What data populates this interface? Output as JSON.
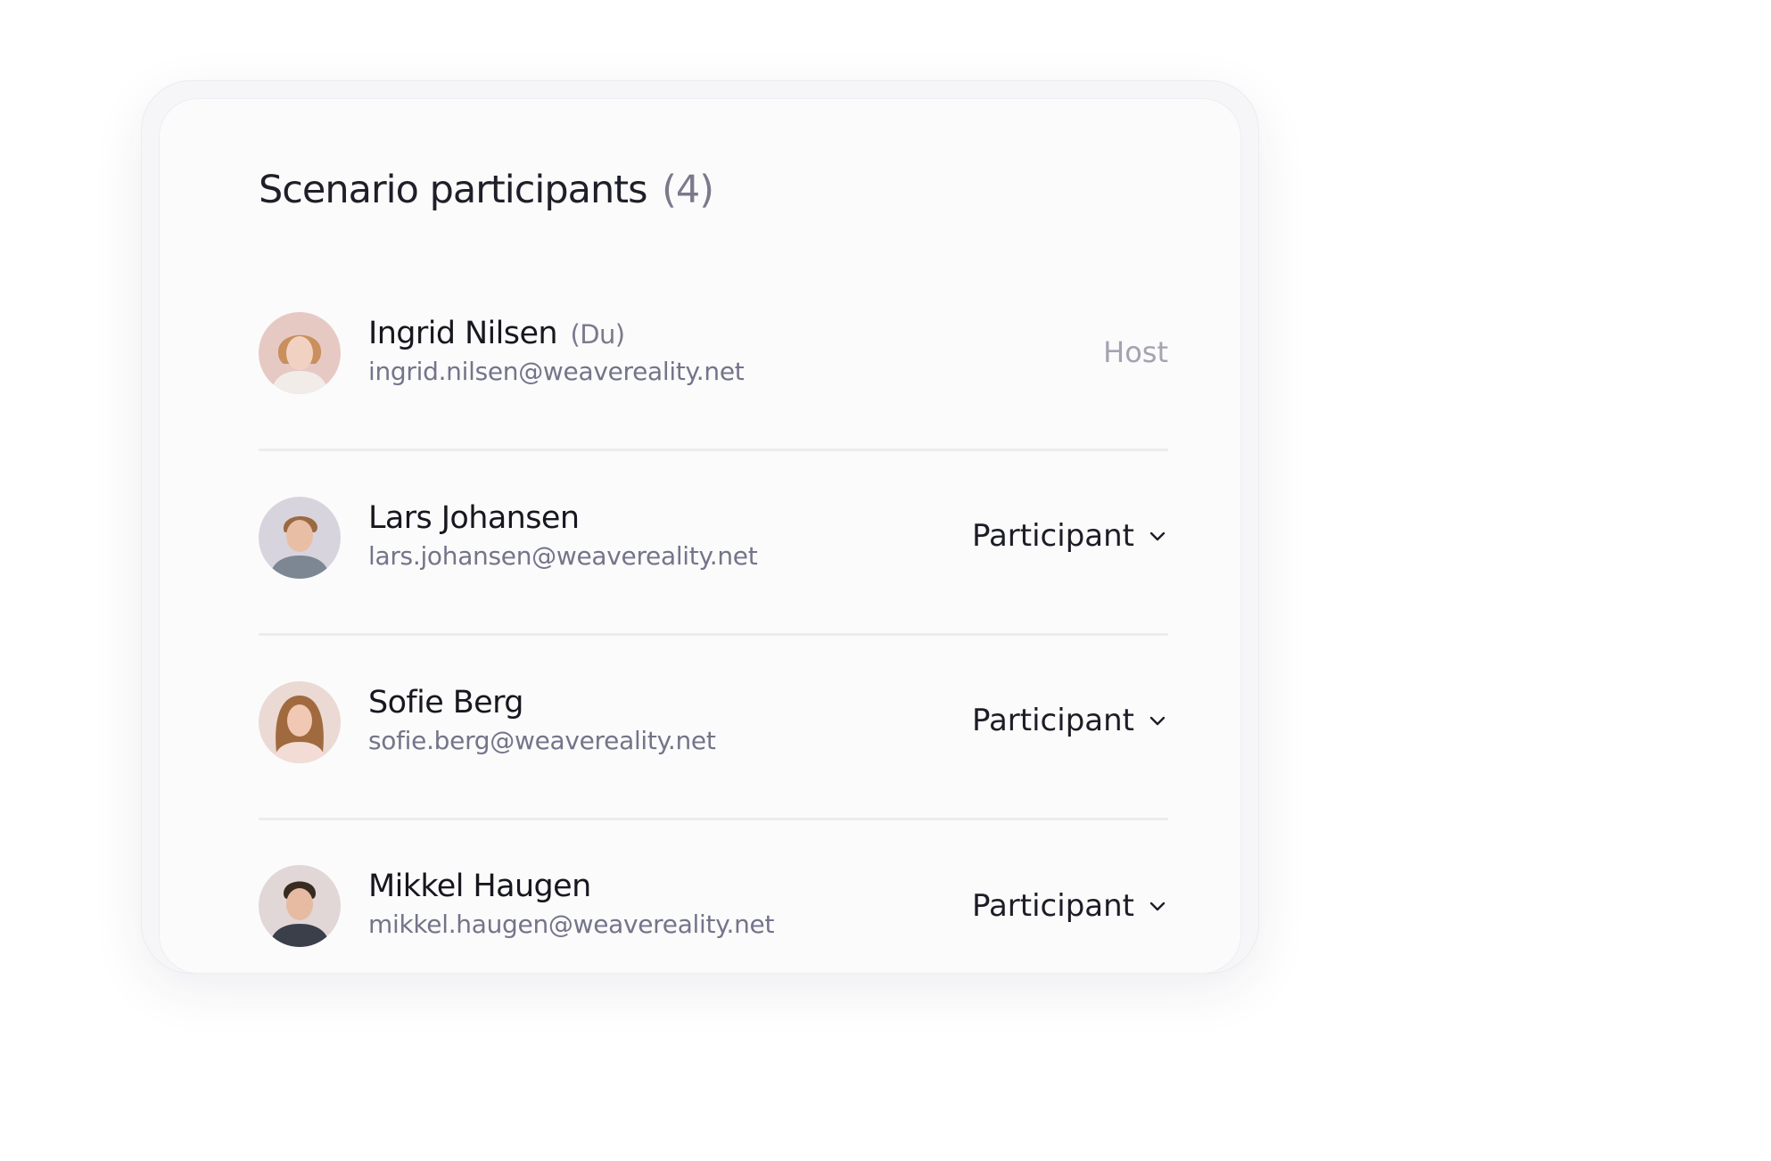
{
  "header": {
    "title": "Scenario participants",
    "count": "(4)"
  },
  "participants": [
    {
      "name": "Ingrid Nilsen",
      "you_tag": "(Du)",
      "email": "ingrid.nilsen@weavereality.net",
      "role": "Host",
      "role_editable": false,
      "avatar_bg": "#e7c9c4",
      "hair_color": "#c98f5c",
      "skin_color": "#f1d2c2",
      "shirt_color": "#f2ece8"
    },
    {
      "name": "Lars Johansen",
      "you_tag": "",
      "email": "lars.johansen@weavereality.net",
      "role": "Participant",
      "role_editable": true,
      "avatar_bg": "#d8d4de",
      "hair_color": "#9a6a42",
      "skin_color": "#e8bfa5",
      "shirt_color": "#7d8794"
    },
    {
      "name": "Sofie Berg",
      "you_tag": "",
      "email": "sofie.berg@weavereality.net",
      "role": "Participant",
      "role_editable": true,
      "avatar_bg": "#ebd9d3",
      "hair_color": "#a06a3e",
      "skin_color": "#f0c8b3",
      "shirt_color": "#f3dcd6"
    },
    {
      "name": "Mikkel Haugen",
      "you_tag": "",
      "email": "mikkel.haugen@weavereality.net",
      "role": "Participant",
      "role_editable": true,
      "avatar_bg": "#e1d7d6",
      "hair_color": "#3a2b22",
      "skin_color": "#e6bba1",
      "shirt_color": "#3b3f4a"
    }
  ],
  "icons": {
    "dropdown": "chevron-down-icon"
  },
  "colors": {
    "title": "#1f1f29",
    "muted": "#7a7a8c",
    "host_label": "#a3a3b2",
    "divider": "#ececef"
  }
}
